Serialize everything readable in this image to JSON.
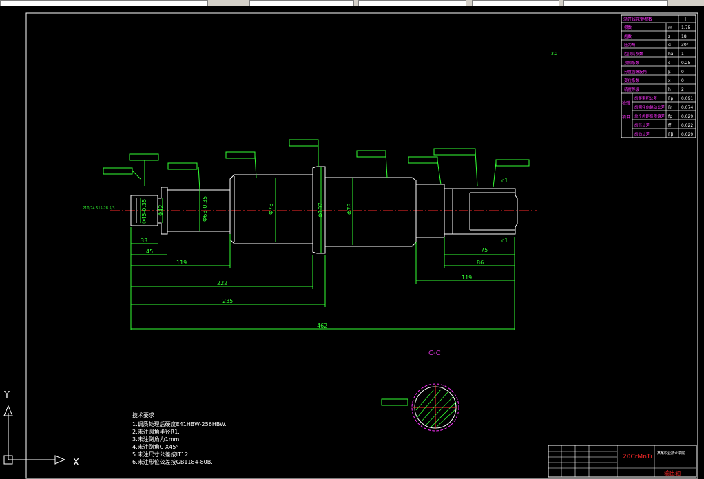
{
  "colors": {
    "background": "#000000",
    "dimension": "#33ff33",
    "geometry": "#ffffff",
    "centerline": "#ff2a2a",
    "table_text": "#ff33ff",
    "toolbar": "#d4d0c8"
  },
  "toolbar": {
    "visible_label": "ISO"
  },
  "drawing": {
    "dims": {
      "d33": "33",
      "d45": "45",
      "d119a": "119",
      "d222": "222",
      "d235": "235",
      "d462": "462",
      "d75": "75",
      "d86": "86",
      "d119b": "119",
      "phi78a": "Φ78",
      "phi107": "Φ107",
      "phi78b": "Φ78",
      "phi42": "Φ42",
      "phi45": "Φ45-0.35",
      "phi63": "Φ63-0.35",
      "c1a": "c1",
      "c1b": "c1"
    },
    "section_label": "C-C",
    "roughness_label": "3.2",
    "left_note": "210/74.515-28.5/3"
  },
  "notes": {
    "title": "技术要求",
    "items": [
      "1.调质处理后硬度E41HBW-256HBW.",
      "2.未注圆角半径R1.",
      "3.未注倒角为1mm.",
      "4.未注倒角C X45°",
      "5.未注尺寸公差按IT12.",
      "6.未注形位公差按GB1184-80B."
    ]
  },
  "param_table": {
    "header": "渐开线花键参数",
    "header_value": "I",
    "rows": [
      {
        "label": "模数",
        "sym": "m",
        "val": "1.75"
      },
      {
        "label": "齿数",
        "sym": "z",
        "val": "18"
      },
      {
        "label": "压力角",
        "sym": "α",
        "val": "30°"
      },
      {
        "label": "齿顶高系数",
        "sym": "ha",
        "val": "1"
      },
      {
        "label": "顶隙系数",
        "sym": "c",
        "val": "0.25"
      },
      {
        "label": "分度圆螺旋角",
        "sym": "β",
        "val": "0"
      },
      {
        "label": "变位系数",
        "sym": "x",
        "val": "0"
      },
      {
        "label": "精度等级",
        "sym": "h",
        "val": "2"
      },
      {
        "label": "齿距累积公差",
        "sym": "Fp",
        "val": "0.091"
      },
      {
        "label": "齿圈径向跳动公差",
        "sym": "Fr",
        "val": "0.074"
      },
      {
        "label": "单个齿距极限偏差",
        "sym": "fp",
        "val": "0.029"
      },
      {
        "label": "齿形公差",
        "sym": "ff",
        "val": "0.022"
      },
      {
        "label": "齿向公差",
        "sym": "Fβ",
        "val": "0.029"
      }
    ],
    "groups": [
      "检验",
      "项目"
    ]
  },
  "title_block": {
    "material": "20CrMnTi",
    "part_name": "输出轴",
    "school": "某某职业技术学院"
  },
  "ucs": {
    "x_label": "X",
    "y_label": "Y"
  }
}
